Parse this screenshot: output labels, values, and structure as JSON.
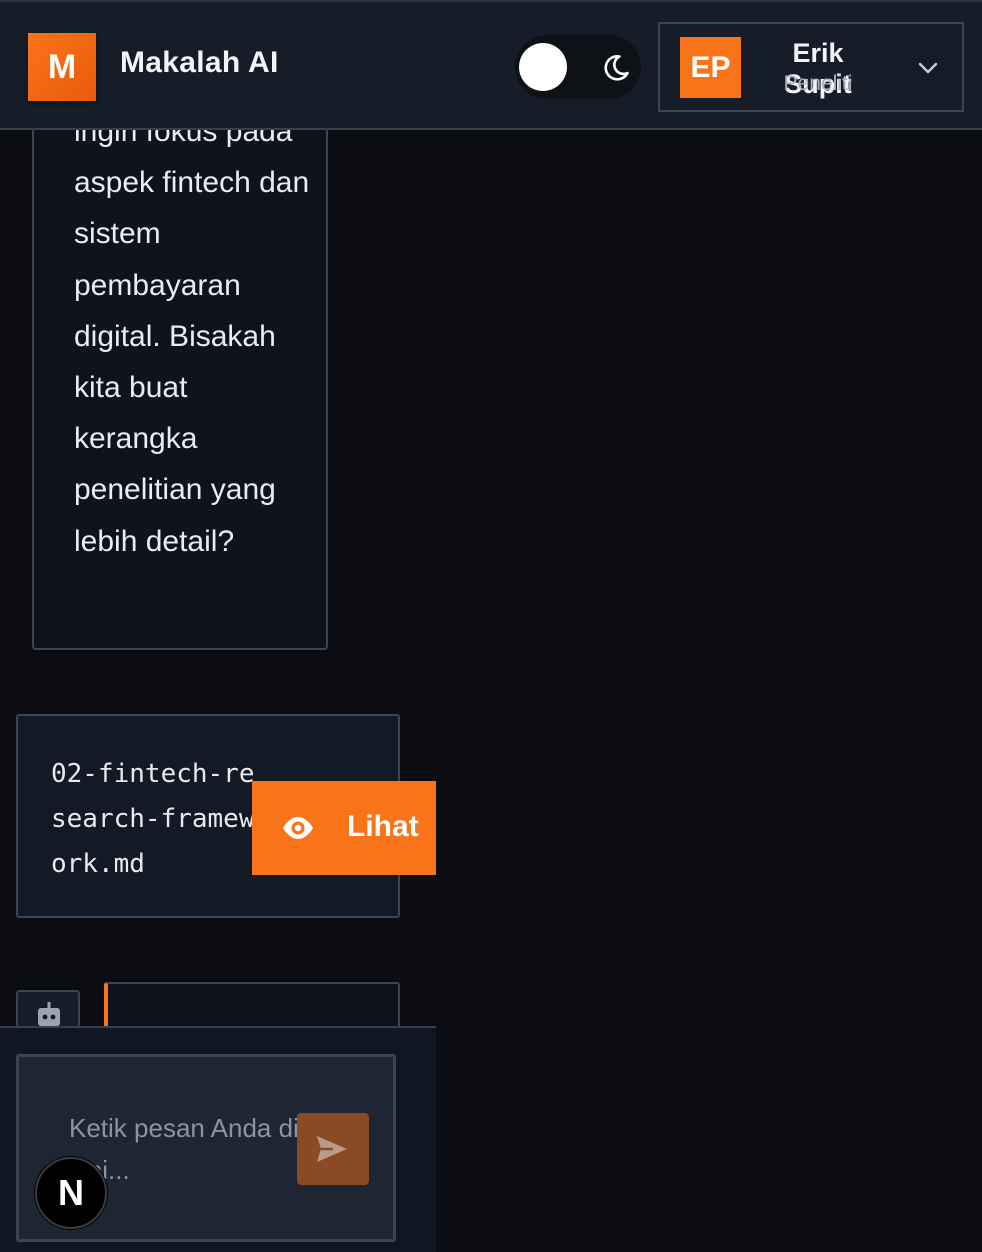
{
  "header": {
    "logo_letter": "M",
    "app_title": "Makalah AI",
    "theme": "dark",
    "user": {
      "initials": "EP",
      "name": "Erik Supit",
      "role": "Peneliti"
    }
  },
  "chat": {
    "user_message": "ingin fokus pada aspek fintech dan sistem pembayaran digital. Bisakah kita buat kerangka penelitian yang lebih detail?",
    "file_card": {
      "file_name": "02-fintech-research-framework.md",
      "view_label": "Lihat"
    }
  },
  "composer": {
    "placeholder": "Ketik pesan Anda di sini..."
  },
  "badge": {
    "letter": "N"
  },
  "colors": {
    "accent": "#f97419",
    "background": "#0b0d12",
    "header_bg": "#161d29",
    "border": "#3a4556"
  },
  "icons": [
    "moon-icon",
    "chevron-down-icon",
    "eye-icon",
    "bot-icon",
    "send-icon"
  ]
}
